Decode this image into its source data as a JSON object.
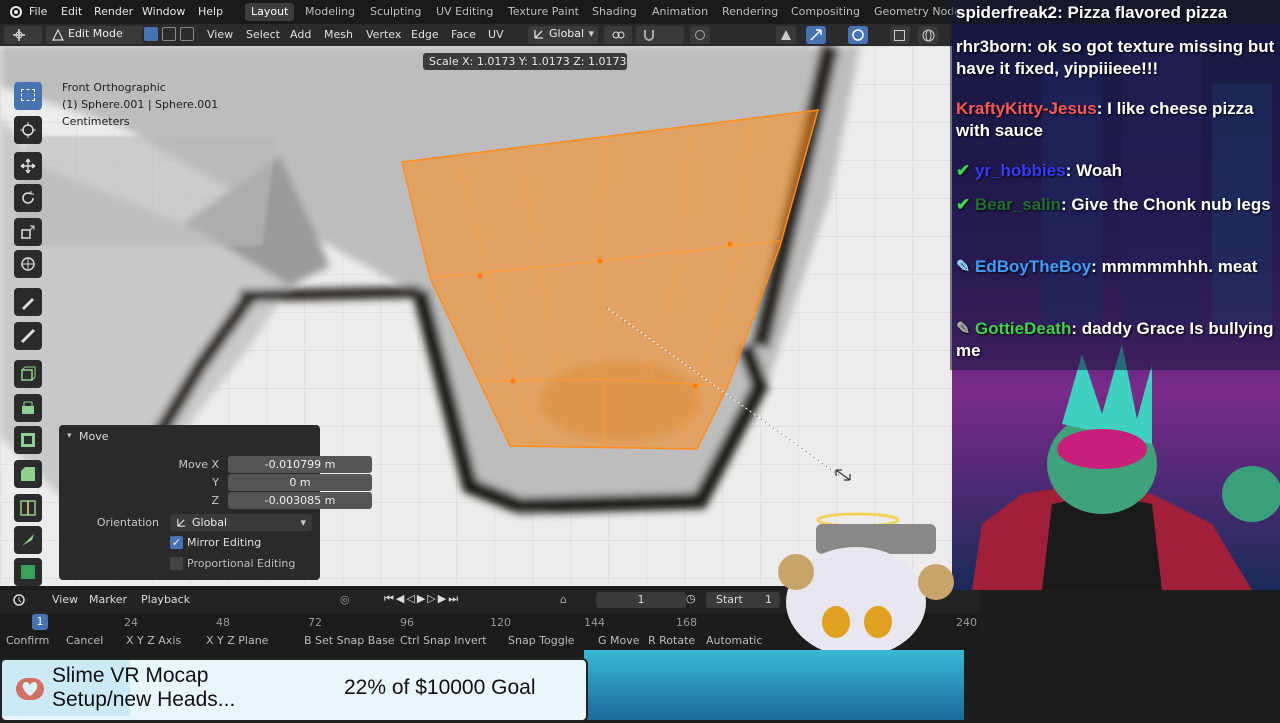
{
  "menubar": {
    "items": [
      "File",
      "Edit",
      "Render",
      "Window",
      "Help"
    ],
    "workspaces": [
      "Layout",
      "Modeling",
      "Sculpting",
      "UV Editing",
      "Texture Paint",
      "Shading",
      "Animation",
      "Rendering",
      "Compositing",
      "Geometry Node"
    ],
    "active_workspace": "Layout"
  },
  "header": {
    "mode": "Edit Mode",
    "menus": [
      "View",
      "Select",
      "Add",
      "Mesh",
      "Vertex",
      "Edge",
      "Face",
      "UV"
    ],
    "transform_orientation": "Global"
  },
  "viewport": {
    "view_name": "Front Orthographic",
    "object_info": "(1) Sphere.001 | Sphere.001",
    "units": "Centimeters",
    "scale_readout": "Scale X: 1.0173   Y: 1.0173  Z: 1.0173"
  },
  "move_panel": {
    "title": "Move",
    "move_x_label": "Move X",
    "move_x": "-0.010799 m",
    "y_label": "Y",
    "y": "0 m",
    "z_label": "Z",
    "z": "-0.003085 m",
    "orientation_label": "Orientation",
    "orientation": "Global",
    "mirror_label": "Mirror Editing",
    "mirror_checked": true,
    "proportional_label": "Proportional Editing",
    "proportional_checked": false
  },
  "timeline": {
    "menus": [
      "View",
      "Marker",
      "Playback"
    ],
    "current_frame": "1",
    "start_label": "Start",
    "start": "1",
    "ticks": [
      "1",
      "24",
      "48",
      "72",
      "96",
      "120",
      "144",
      "168",
      "240"
    ]
  },
  "statusbar": {
    "items": [
      "Confirm",
      "Cancel",
      "X Y Z Axis",
      "X Y Z Plane",
      "B Set Snap Base",
      "Ctrl Snap Invert",
      "Snap Toggle",
      "G Move",
      "R Rotate",
      "Automatic"
    ]
  },
  "chat": [
    {
      "name": "spiderfreak2",
      "msg": "Pizza flavored pizza",
      "color": "#ffffff"
    },
    {
      "name": "rhr3born",
      "msg": "ok so got texture missing but have it fixed, yippiiieee!!!",
      "color": "#ffffff"
    },
    {
      "name": "KraftyKitty-Jesus",
      "msg": "I like cheese pizza with sauce",
      "color": "#ff5a5a"
    },
    {
      "name": "yr_hobbies",
      "msg": "Woah",
      "color": "#3a3aff"
    },
    {
      "name": "Bear_salin",
      "msg": "Give the Chonk nub legs",
      "color": "#1f6f2f"
    },
    {
      "name": "EdBoyTheBoy",
      "msg": "mmmmmhhh. meat",
      "color": "#3da0ff"
    },
    {
      "name": "GottieDeath",
      "msg": "daddy Grace Is bullying me",
      "color": "#3cd44a"
    }
  ],
  "banner": {
    "title_line1": "Slime VR Mocap",
    "title_line2": "Setup/new Heads...",
    "goal": "22% of $10000 Goal",
    "progress": 0.22
  },
  "colors": {
    "accent": "#4772b3",
    "selection_orange": "#ff8c1a",
    "viewport_bg": "#e9e9e9"
  }
}
